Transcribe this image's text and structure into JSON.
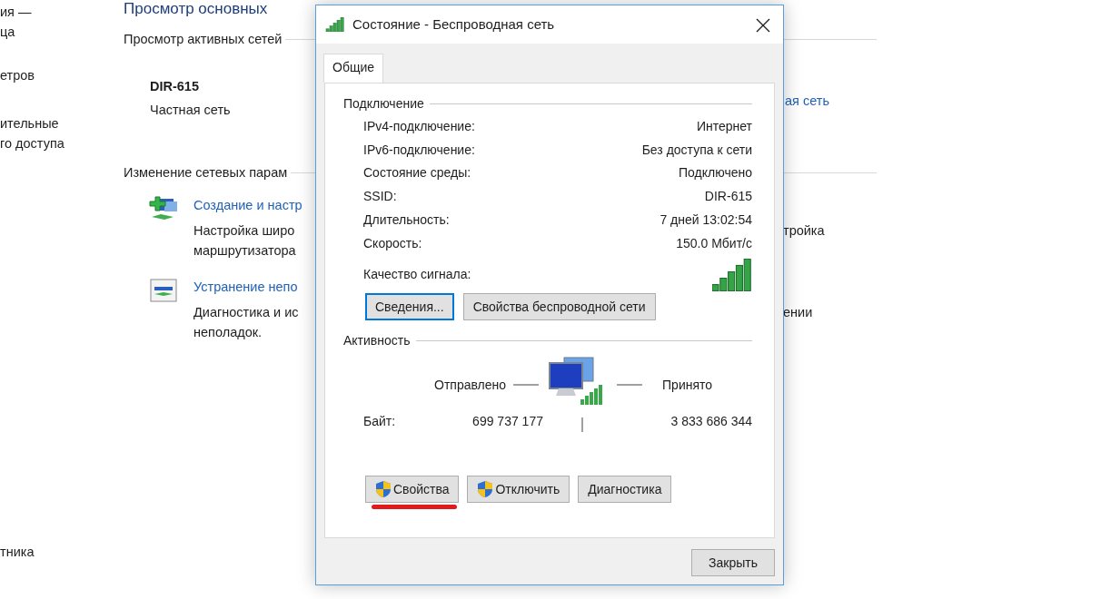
{
  "background": {
    "heading": "Просмотр основных",
    "sidebar": [
      [
        "ия —",
        "ца"
      ],
      [
        "етров"
      ],
      [
        "ительные",
        "го доступа"
      ],
      [
        "тника"
      ]
    ],
    "active_networks_label": "Просмотр активных сетей",
    "network": {
      "name": "DIR-615",
      "type": "Частная сеть",
      "right_link": "ая сеть"
    },
    "change_label": "Изменение сетевых парам",
    "tasks": [
      {
        "kind": "setup",
        "link": "Создание и настр",
        "description": [
          "Настройка широ",
          "маршрутизатора"
        ],
        "right_fragment": "тройка"
      },
      {
        "kind": "troubleshoot",
        "link": "Устранение непо",
        "description": [
          "Диагностика и ис",
          "неполадок."
        ],
        "right_fragment": "ении"
      }
    ]
  },
  "dialog": {
    "title": "Состояние - Беспроводная сеть",
    "tabs": [
      {
        "label": "Общие",
        "selected": true
      }
    ],
    "connection": {
      "label": "Подключение",
      "rows": [
        {
          "label": "IPv4-подключение:",
          "value": "Интернет"
        },
        {
          "label": "IPv6-подключение:",
          "value": "Без доступа к сети"
        },
        {
          "label": "Состояние среды:",
          "value": "Подключено"
        },
        {
          "label": "SSID:",
          "value": "DIR-615"
        },
        {
          "label": "Длительность:",
          "value": "7 дней 13:02:54"
        },
        {
          "label": "Скорость:",
          "value": "150.0 Мбит/с"
        }
      ],
      "signal_label": "Качество сигнала:",
      "buttons": [
        {
          "label": "Сведения...",
          "focused": true
        },
        {
          "label": "Свойства беспроводной сети",
          "focused": false
        }
      ]
    },
    "activity": {
      "label": "Активность",
      "sent_label": "Отправлено",
      "received_label": "Принято",
      "bytes_label": "Байт:",
      "sent": "699 737 177",
      "received": "3 833 686 344"
    },
    "buttons": [
      {
        "label": "Свойства",
        "shield": true,
        "underlined": true
      },
      {
        "label": "Отключить",
        "shield": true,
        "underlined": false
      },
      {
        "label": "Диагностика",
        "shield": false,
        "underlined": false
      }
    ],
    "close_button": "Закрыть"
  }
}
